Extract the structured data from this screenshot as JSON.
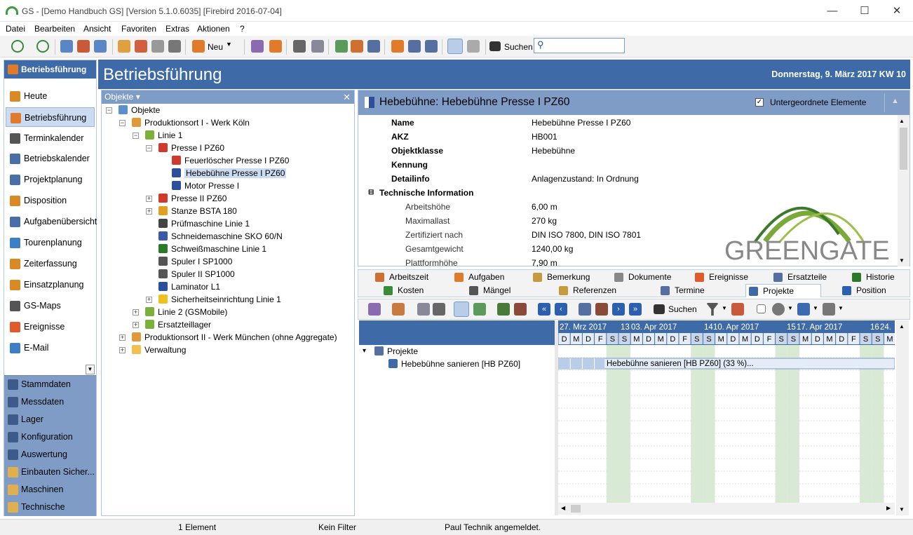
{
  "window": {
    "title": "GS - [Demo Handbuch GS]  [Version  5.1.0.6035]  [Firebird 2016-07-04]"
  },
  "menu": [
    "Datei",
    "Bearbeiten",
    "Ansicht",
    "Favoriten",
    "Extras",
    "Aktionen",
    "?"
  ],
  "toolbar": {
    "new_label": "Neu",
    "search_label": "Suchen",
    "search_value": ""
  },
  "leftnav": {
    "header": "Betriebsführung",
    "items": [
      {
        "label": "Heute",
        "icon": "clock-icon",
        "color": "#d98a24"
      },
      {
        "label": "Betriebsführung",
        "icon": "checklist-icon",
        "color": "#e07b2c"
      },
      {
        "label": "Terminkalender",
        "icon": "calendar-icon",
        "color": "#555555"
      },
      {
        "label": "Betriebskalender",
        "icon": "calendar-icon",
        "color": "#4a6ea8"
      },
      {
        "label": "Projektplanung",
        "icon": "project-icon",
        "color": "#4a6ea8"
      },
      {
        "label": "Disposition",
        "icon": "dispo-icon",
        "color": "#d98a24"
      },
      {
        "label": "Aufgabenübersicht",
        "icon": "tasks-icon",
        "color": "#4a6ea8"
      },
      {
        "label": "Tourenplanung",
        "icon": "route-icon",
        "color": "#3d7fc4"
      },
      {
        "label": "Zeiterfassung",
        "icon": "time-icon",
        "color": "#d98a24"
      },
      {
        "label": "Einsatzplanung",
        "icon": "plan-icon",
        "color": "#d98a24"
      },
      {
        "label": "GS-Maps",
        "icon": "globe-icon",
        "color": "#555555"
      },
      {
        "label": "Ereignisse",
        "icon": "event-icon",
        "color": "#e05a2c"
      },
      {
        "label": "E-Mail",
        "icon": "at-icon",
        "color": "#3d7fc4"
      }
    ],
    "sections": [
      {
        "label": "Stammdaten",
        "icon": "people-icon"
      },
      {
        "label": "Messdaten",
        "icon": "gauge-icon"
      },
      {
        "label": "Lager",
        "icon": "hand-icon"
      },
      {
        "label": "Konfiguration",
        "icon": "gear-icon"
      },
      {
        "label": "Auswertung",
        "icon": "chart-icon"
      },
      {
        "label": "Einbauten Sicher...",
        "icon": "folder-icon"
      },
      {
        "label": "Maschinen",
        "icon": "folder-icon"
      },
      {
        "label": "Technische Einric...",
        "icon": "folder-icon"
      }
    ]
  },
  "main": {
    "title": "Betriebsführung",
    "date": "Donnerstag, 9. März 2017  KW 10"
  },
  "tree": {
    "header": "Objekte ▾",
    "nodes": [
      {
        "label": "Objekte",
        "level": 0,
        "exp": "-",
        "color": "#5a8fd0"
      },
      {
        "label": "Produktionsort I - Werk Köln",
        "level": 1,
        "exp": "-",
        "color": "#e09a3a"
      },
      {
        "label": "Linie 1",
        "level": 2,
        "exp": "-",
        "color": "#7bb03a"
      },
      {
        "label": "Presse I PZ60",
        "level": 3,
        "exp": "-",
        "color": "#d03a2c"
      },
      {
        "label": "Feuerlöscher Presse I PZ60",
        "level": 4,
        "exp": "",
        "color": "#d03a2c"
      },
      {
        "label": "Hebebühne Presse I PZ60",
        "level": 4,
        "exp": "",
        "color": "#2b4f9a",
        "sel": true
      },
      {
        "label": "Motor Presse I",
        "level": 4,
        "exp": "",
        "color": "#2b4f9a"
      },
      {
        "label": "Presse II PZ60",
        "level": 3,
        "exp": "+",
        "color": "#d03a2c"
      },
      {
        "label": "Stanze BSTA 180",
        "level": 3,
        "exp": "+",
        "color": "#e0a020"
      },
      {
        "label": "Prüfmaschine Linie 1",
        "level": 3,
        "exp": "",
        "color": "#444444"
      },
      {
        "label": "Schneidemaschine SKO 60/N",
        "level": 3,
        "exp": "",
        "color": "#3a5aa8"
      },
      {
        "label": "Schweißmaschine Linie 1",
        "level": 3,
        "exp": "",
        "color": "#2a7a2a"
      },
      {
        "label": "Spuler I SP1000",
        "level": 3,
        "exp": "",
        "color": "#555555"
      },
      {
        "label": "Spuler II SP1000",
        "level": 3,
        "exp": "",
        "color": "#555555"
      },
      {
        "label": "Laminator L1",
        "level": 3,
        "exp": "",
        "color": "#2b4f9a"
      },
      {
        "label": "Sicherheitseinrichtung Linie 1",
        "level": 3,
        "exp": "+",
        "color": "#f0c020"
      },
      {
        "label": "Linie 2 (GSMobile)",
        "level": 2,
        "exp": "+",
        "color": "#7bb03a"
      },
      {
        "label": "Ersatzteillager",
        "level": 2,
        "exp": "+",
        "color": "#7bb03a"
      },
      {
        "label": "Produktionsort II - Werk München (ohne Aggregate)",
        "level": 1,
        "exp": "+",
        "color": "#e09a3a"
      },
      {
        "label": "Verwaltung",
        "level": 1,
        "exp": "+",
        "color": "#f0c050"
      }
    ]
  },
  "detail": {
    "title": "Hebebühne: Hebebühne Presse I PZ60",
    "checkbox_label": "Untergeordnete Elemente",
    "props": [
      {
        "k": "Name",
        "v": "Hebebühne Presse I PZ60",
        "bold": true
      },
      {
        "k": "AKZ",
        "v": "HB001",
        "bold": true
      },
      {
        "k": "Objektklasse",
        "v": "Hebebühne",
        "bold": true
      },
      {
        "k": "Kennung",
        "v": "",
        "bold": true
      },
      {
        "k": "Detailinfo",
        "v": "Anlagenzustand: In Ordnung",
        "bold": true
      }
    ],
    "group": "Technische Information",
    "tech": [
      {
        "k": "Arbeitshöhe",
        "v": "6,00 m"
      },
      {
        "k": "Maximallast",
        "v": "270 kg"
      },
      {
        "k": "Zertifiziert nach",
        "v": "DIN ISO 7800, DIN ISO 7801"
      },
      {
        "k": "Gesamtgewicht",
        "v": "1240,00 kg"
      },
      {
        "k": "Plattformhöhe",
        "v": "7,90 m"
      }
    ],
    "logo_text": "GREENGATE"
  },
  "tabs": {
    "row1": [
      "Arbeitszeit",
      "Aufgaben",
      "Bemerkung",
      "Dokumente",
      "Ereignisse",
      "Ersatzteile",
      "Historie"
    ],
    "row2": [
      "Kosten",
      "Mängel",
      "Referenzen",
      "Termine",
      "Projekte",
      "Position"
    ],
    "active": "Projekte"
  },
  "projects": {
    "search_label": "Suchen",
    "tree": [
      {
        "label": "Projekte",
        "level": 0
      },
      {
        "label": "Hebebühne sanieren [HB PZ60]",
        "level": 1
      }
    ],
    "weeks": [
      "27. Mrz 2017",
      "13",
      "03. Apr 2017",
      "14",
      "10. Apr 2017",
      "15",
      "17. Apr 2017",
      "16",
      "24."
    ],
    "days": [
      "D",
      "M",
      "D",
      "F",
      "S",
      "S",
      "M",
      "D",
      "M",
      "D",
      "F",
      "S",
      "S",
      "M",
      "D",
      "M",
      "D",
      "F",
      "S",
      "S",
      "M",
      "D",
      "M",
      "D",
      "F",
      "S",
      "S",
      "M"
    ],
    "bar_label": "Hebebühne sanieren [HB PZ60] (33 %)...",
    "progress": 0.33
  },
  "status": {
    "count": "1 Element",
    "filter": "Kein Filter",
    "user": "Paul Technik angemeldet."
  }
}
